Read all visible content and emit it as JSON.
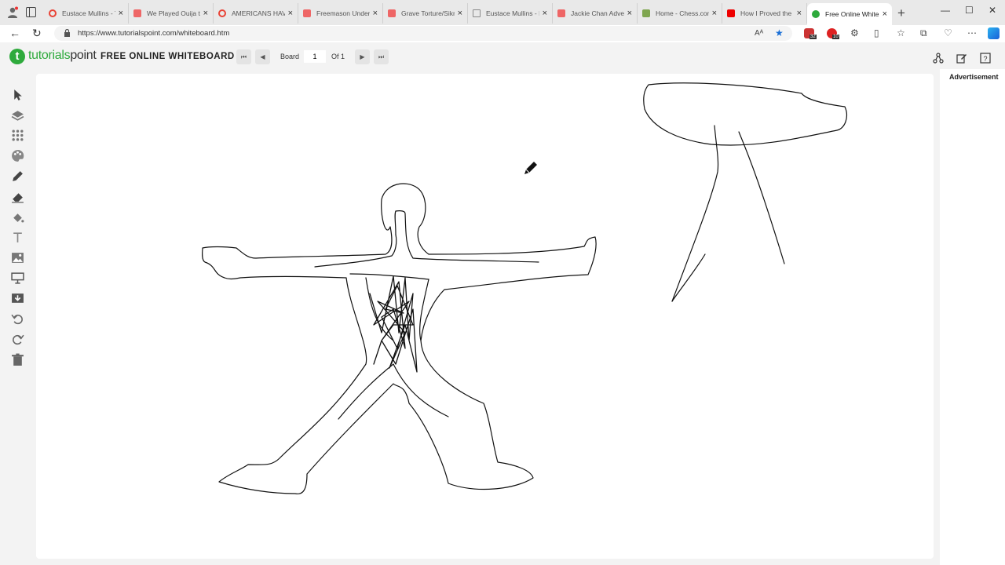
{
  "browser": {
    "tabs": [
      {
        "title": "Eustace Mullins - T",
        "favicon": "google-icon",
        "color": "#e94235",
        "active": false
      },
      {
        "title": "We Played Ouija to",
        "favicon": "youtube-icon",
        "color": "#e66",
        "active": false
      },
      {
        "title": "AMERICANS HAVE",
        "favicon": "google-icon",
        "color": "#e94235",
        "active": false
      },
      {
        "title": "Freemason Underg",
        "favicon": "youtube-icon",
        "color": "#e66",
        "active": false
      },
      {
        "title": "Grave Torture/Sikr",
        "favicon": "youtube-icon",
        "color": "#e66",
        "active": false
      },
      {
        "title": "Eustace Mullins - N",
        "favicon": "page-icon",
        "color": "#888",
        "active": false
      },
      {
        "title": "Jackie Chan Adven",
        "favicon": "youtube-icon",
        "color": "#e66",
        "active": false
      },
      {
        "title": "Home - Chess.com",
        "favicon": "chess-icon",
        "color": "#7fa650",
        "active": false
      },
      {
        "title": "How I Proved the N",
        "favicon": "youtube-icon",
        "color": "#e00",
        "active": false
      },
      {
        "title": "Free Online Whitel",
        "favicon": "tutorialspoint-icon",
        "color": "#2eaa3c",
        "active": true
      }
    ],
    "tab_close": "×",
    "new_tab": "+",
    "window_controls": {
      "minimize": "—",
      "maximize": "☐",
      "close": "✕"
    },
    "url": "https://www.tutorialspoint.com/whiteboard.htm",
    "reader_label": "Aᴬ",
    "extension_badges": [
      "32",
      "10"
    ]
  },
  "app": {
    "logo_letter": "t",
    "logo_text_brand": "tutorials",
    "logo_text_rest": "point",
    "title": "FREE ONLINE WHITEBOARD",
    "board_label": "Board",
    "board_value": "1",
    "of_label": "Of 1",
    "nav": {
      "first": "⏮",
      "prev": "◀",
      "next": "▶",
      "last": "⏭"
    },
    "right_icons": [
      "share-icon",
      "edit-icon",
      "help-icon"
    ],
    "advertisement_label": "Advertisement"
  },
  "toolbar": {
    "tools": [
      "select-tool",
      "layers-tool",
      "grid-tool",
      "palette-tool",
      "pencil-tool",
      "eraser-tool",
      "fill-tool",
      "text-tool",
      "image-tool",
      "presentation-tool",
      "download-tool",
      "undo-tool",
      "redo-tool",
      "trash-tool"
    ]
  },
  "colors": {
    "brand_green": "#2eaa3c",
    "stroke": "#111111"
  }
}
